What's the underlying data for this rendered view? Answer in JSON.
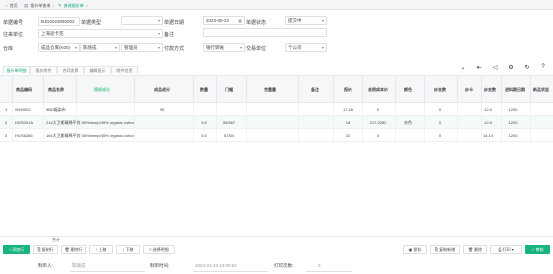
{
  "tabs": [
    {
      "label": "首页",
      "icon": "home-icon"
    },
    {
      "label": "报价单查询",
      "icon": "doc-icon"
    },
    {
      "label": "修改报价单",
      "icon": "edit-icon"
    }
  ],
  "form": {
    "doc_no_label": "单据编号",
    "doc_no": "BJD2023050002",
    "doc_type_label": "单据类型",
    "doc_type": "",
    "doc_date_label": "单据日期",
    "doc_date": "2023-05-22",
    "doc_status_label": "单据状态",
    "doc_status": "提交中",
    "customer_label": "往来单位",
    "customer": "上海途卡克",
    "remark_label": "备注",
    "remark": "",
    "warehouse_label": "仓库",
    "warehouse": "成品仓库(K00)",
    "salesman": "陈晓成",
    "dept": "管理员",
    "pay_label": "付款方式",
    "pay": "银行转账",
    "settle_label": "交易单位",
    "settle": "个公司"
  },
  "subtabs": [
    "报价单明细",
    "报价附件",
    "合同发票",
    "编辑显示",
    "附件信息"
  ],
  "toolbar_icons": [
    "collapse-icon",
    "first-page-icon",
    "prev-page-icon",
    "settings-icon",
    "refresh-icon",
    "help-icon"
  ],
  "table": {
    "headers": [
      "商品编码",
      "商品名称",
      "规格成分",
      "成品成分",
      "数量",
      "门幅",
      "克重量",
      "备注",
      "报价",
      "含税成本价",
      "颜色",
      "纱支数",
      "纱卡",
      "纱支数",
      "进料期日期",
      "新品状态"
    ],
    "rows": [
      {
        "no": "1",
        "code": "WH0002",
        "name": "5BD幅染布",
        "spec": "",
        "comp": "35",
        "qty": "",
        "width": "",
        "weight": "",
        "remark": "",
        "price": "17.45",
        "cost": "0",
        "color": "",
        "yarn": "0",
        "cnt": "",
        "yarn2": "12.6",
        "date": "1200"
      },
      {
        "no": "2",
        "code": "HGS001A",
        "name": "21s大卫斯精棉平纹 55%hemp/45% organic cotton",
        "spec": "",
        "comp": "",
        "qty": "3.9",
        "width": "55/567",
        "weight": "",
        "remark": "",
        "price": "18",
        "cost": "217.0282",
        "color": "灰色",
        "yarn": "0",
        "cnt": "",
        "yarn2": "12.6",
        "date": "1200"
      },
      {
        "no": "3",
        "code": "HGS6266",
        "name": "16s大卫斯精棉平纹 55%hemp/45% organic cotton",
        "spec": "",
        "comp": "",
        "qty": "5.0",
        "width": "57/54",
        "weight": "",
        "remark": "",
        "price": "22",
        "cost": "0",
        "color": "",
        "yarn": "0",
        "cnt": "",
        "yarn2": "14.14",
        "date": "1200"
      }
    ],
    "sum_label": "合计"
  },
  "row_buttons": [
    "添加行",
    "复制行",
    "删除行",
    "上移",
    "下移",
    "选择明细"
  ],
  "action_buttons": [
    "保存",
    "复制新增",
    "删除",
    "打印",
    "审核"
  ],
  "footer": {
    "maker_label": "制单人:",
    "maker": "陈晓成",
    "time_label": "制单时间:",
    "time": "2024-01-23 13:09:54",
    "print_label": "打印次数:",
    "print_count": "0"
  },
  "colors": {
    "accent": "#17b47e",
    "header_bg": "#f5f7f9"
  }
}
